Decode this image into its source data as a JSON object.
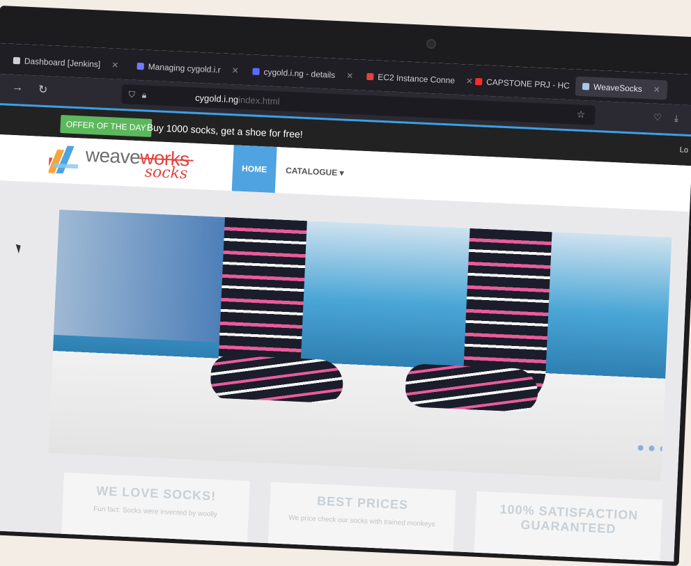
{
  "browser": {
    "tabs": [
      {
        "title": "Dashboard [Jenkins]",
        "icon": "jenkins-icon",
        "color": "#cfcfd4",
        "active": false
      },
      {
        "title": "Managing cygold.i.r",
        "icon": "page-icon",
        "color": "#6f7cff",
        "active": false
      },
      {
        "title": "cygold.i.ng - details",
        "icon": "globe-icon",
        "color": "#5a6cff",
        "active": false
      },
      {
        "title": "EC2 Instance Conne",
        "icon": "aws-icon",
        "color": "#e2433e",
        "active": false
      },
      {
        "title": "CAPSTONE PRJ - HC",
        "icon": "youtube-icon",
        "color": "#ff2b2b",
        "active": false
      },
      {
        "title": "WeaveSocks",
        "icon": "weavesocks-icon",
        "color": "#a9c6e8",
        "active": true
      }
    ],
    "url": {
      "prefix": "",
      "domain": "cygold.i.ng",
      "path": "index.html"
    }
  },
  "site": {
    "offer": {
      "badge": "OFFER OF THE DAY",
      "text": "Buy 1000 socks, get a shoe for free!"
    },
    "login": "Lo",
    "logo": {
      "weave": "weave",
      "works": "works",
      "socks": "socks"
    },
    "nav": {
      "home": "HOME",
      "catalogue": "CATALOGUE ▾"
    },
    "features": [
      {
        "title": "WE LOVE SOCKS!",
        "text": "Fun fact: Socks were invented by woolly"
      },
      {
        "title": "BEST PRICES",
        "text": "We price check our socks with trained monkeys"
      },
      {
        "title": "100% SATISFACTION GUARANTEED",
        "text": ""
      }
    ]
  },
  "colors": {
    "accent": "#4fa3e0",
    "offer": "#5cb85c",
    "brand": "#e2433e"
  }
}
